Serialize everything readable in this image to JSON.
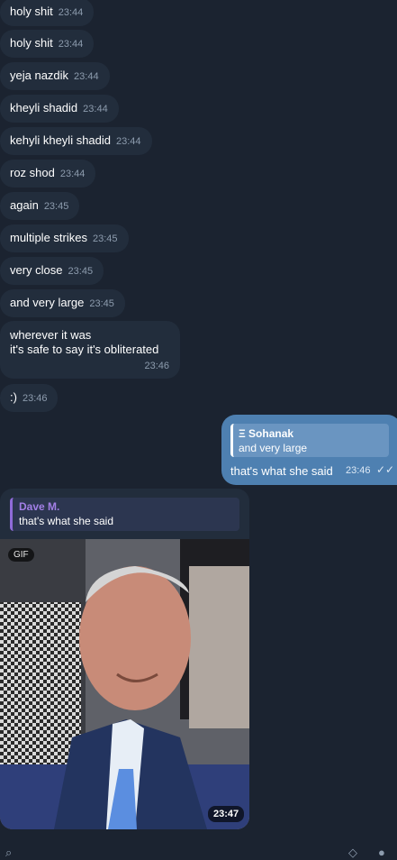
{
  "messages": [
    {
      "text": "holy shit",
      "time": "23:44"
    },
    {
      "text": "holy shit",
      "time": "23:44"
    },
    {
      "text": "yeja nazdik",
      "time": "23:44"
    },
    {
      "text": "kheyli shadid",
      "time": "23:44"
    },
    {
      "text": "kehyli kheyli shadid",
      "time": "23:44"
    },
    {
      "text": "roz shod",
      "time": "23:44"
    },
    {
      "text": "again",
      "time": "23:45"
    },
    {
      "text": "multiple strikes",
      "time": "23:45"
    },
    {
      "text": "very close",
      "time": "23:45"
    },
    {
      "text": "and very large",
      "time": "23:45"
    }
  ],
  "multi_message": {
    "line1": "wherever it was",
    "line2": "it's safe to say it's obliterated",
    "time": "23:46"
  },
  "smile_message": {
    "text": ":)",
    "time": "23:46"
  },
  "outgoing": {
    "quote_name": "Ξ Sohanak",
    "quote_text": "and very large",
    "text": "that's what she said",
    "time": "23:46",
    "check": "✓✓"
  },
  "gif_message": {
    "quote_name": "Dave M.",
    "quote_text": "that's what she said",
    "badge": "GIF",
    "time": "23:47"
  },
  "colors": {
    "background": "#1b2330",
    "incoming": "#222d3c",
    "outgoing": "#4e80b1",
    "reply_accent": "#a27fe6"
  }
}
